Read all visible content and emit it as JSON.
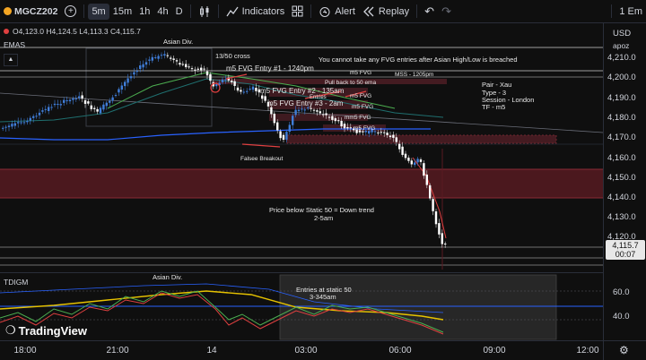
{
  "toolbar": {
    "symbol": "MGCZ202",
    "timeframes": [
      "5m",
      "15m",
      "1h",
      "4h",
      "D"
    ],
    "active_timeframe": "5m",
    "indicators_label": "Indicators",
    "alert_label": "Alert",
    "replay_label": "Replay",
    "right_label": "1 Em"
  },
  "legend": {
    "ohlc": "O4,123.0 H4,124.5 L4,113.3 C4,115.7",
    "emas_label": "EMAS",
    "tdigm_label": "TDIGM"
  },
  "price_axis": {
    "currency": "USD",
    "scale": "apoz",
    "ticks": [
      "4,210.0",
      "4,200.0",
      "4,190.0",
      "4,180.0",
      "4,170.0",
      "4,160.0",
      "4,150.0",
      "4,140.0",
      "4,130.0",
      "4,120.0"
    ],
    "last_price": "4,115.7",
    "countdown": "00:07"
  },
  "indicator_axis": {
    "ticks": [
      "60.0",
      "40.0"
    ]
  },
  "time_axis": {
    "ticks": [
      "18:00",
      "21:00",
      "14",
      "03:00",
      "06:00",
      "09:00",
      "12:00"
    ]
  },
  "annotations": {
    "asian_div": "Asian Div.",
    "cross": "13/50 cross",
    "entry1": "m5 FVG Entry #1 - 1240pm",
    "entry2": "m5 FVG Entry #2 - 135am",
    "entry3": "m5 FVG Entry #3 - 2am",
    "pullback": "Pull back to 50 ema",
    "entries": "Entries",
    "warning": "You cannot take any FVG entries after Asian High/Low is breached",
    "m5fvg_a": "m5 FVG",
    "mss": "MSS - 1205pm",
    "m5fvg_b": "m5 FVG",
    "m5fvg_c": "m5 FVG",
    "m5fvg_d": "mm5 FVG",
    "m5fvg_e": "m5 FVG",
    "pair": "Pair - Xau",
    "type": "Type - 3",
    "session": "Session - London",
    "tf": "TF - m5",
    "false_breakout": "Falsee Breakout",
    "below50": "Price below Static 50 = Down trend",
    "below50_time": "2-5am",
    "static50": "Entries at static 50",
    "static50_time": "3-345am",
    "asian_div2": "Asian Div."
  },
  "brand": "TradingView",
  "colors": {
    "up": "#3f7dd8",
    "down": "#ffffff",
    "accent": "#2962ff",
    "zone": "#5a1a22"
  }
}
